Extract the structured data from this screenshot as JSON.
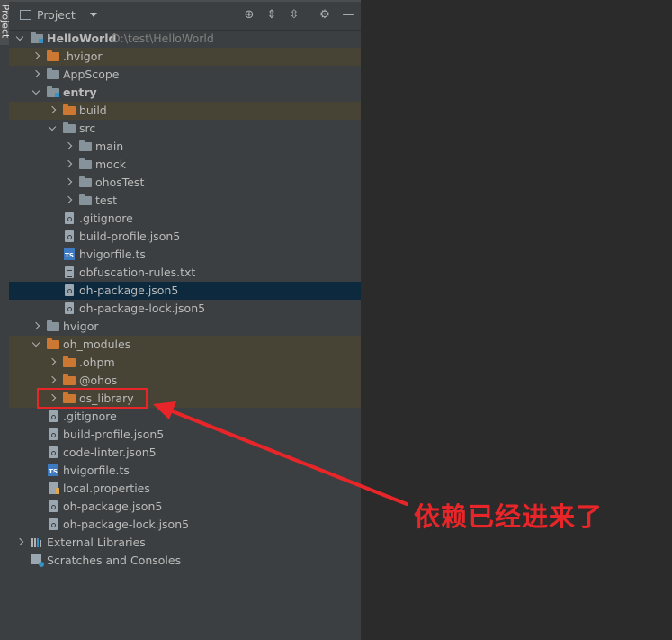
{
  "header": {
    "title": "Project",
    "icons": [
      "locate-icon",
      "expand-all-icon",
      "collapse-all-icon",
      "gear-icon",
      "minimize-icon"
    ]
  },
  "side_tab": {
    "label": "Project"
  },
  "tree": [
    {
      "label": "HelloWorld",
      "path": "D:\\test\\HelloWorld",
      "arrow": "down",
      "icon": "module-folder",
      "indent": 0,
      "bold": true
    },
    {
      "label": ".hvigor",
      "arrow": "right",
      "icon": "folder-orange",
      "indent": 1,
      "highlight": true
    },
    {
      "label": "AppScope",
      "arrow": "right",
      "icon": "folder",
      "indent": 1
    },
    {
      "label": "entry",
      "arrow": "down",
      "icon": "module-folder",
      "indent": 1,
      "bold": true
    },
    {
      "label": "build",
      "arrow": "right",
      "icon": "folder-orange",
      "indent": 2,
      "highlight": true
    },
    {
      "label": "src",
      "arrow": "down",
      "icon": "folder",
      "indent": 2
    },
    {
      "label": "main",
      "arrow": "right",
      "icon": "folder",
      "indent": 3
    },
    {
      "label": "mock",
      "arrow": "right",
      "icon": "folder",
      "indent": 3
    },
    {
      "label": "ohosTest",
      "arrow": "right",
      "icon": "folder",
      "indent": 3
    },
    {
      "label": "test",
      "arrow": "right",
      "icon": "folder",
      "indent": 3
    },
    {
      "label": ".gitignore",
      "icon": "config-file",
      "indent": 2
    },
    {
      "label": "build-profile.json5",
      "icon": "config-file",
      "indent": 2
    },
    {
      "label": "hvigorfile.ts",
      "icon": "ts-file",
      "indent": 2
    },
    {
      "label": "obfuscation-rules.txt",
      "icon": "text-file",
      "indent": 2
    },
    {
      "label": "oh-package.json5",
      "icon": "config-file",
      "indent": 2,
      "selected": true
    },
    {
      "label": "oh-package-lock.json5",
      "icon": "config-file",
      "indent": 2
    },
    {
      "label": "hvigor",
      "arrow": "right",
      "icon": "folder",
      "indent": 1
    },
    {
      "label": "oh_modules",
      "arrow": "down",
      "icon": "folder-orange",
      "indent": 1,
      "highlight": true
    },
    {
      "label": ".ohpm",
      "arrow": "right",
      "icon": "folder-orange",
      "indent": 2,
      "highlight": true
    },
    {
      "label": "@ohos",
      "arrow": "right",
      "icon": "folder-orange",
      "indent": 2,
      "highlight": true
    },
    {
      "label": "os_library",
      "arrow": "right",
      "icon": "folder-orange",
      "indent": 2,
      "highlight": true
    },
    {
      "label": ".gitignore",
      "icon": "config-file",
      "indent": 1
    },
    {
      "label": "build-profile.json5",
      "icon": "config-file",
      "indent": 1
    },
    {
      "label": "code-linter.json5",
      "icon": "config-file",
      "indent": 1
    },
    {
      "label": "hvigorfile.ts",
      "icon": "ts-file",
      "indent": 1
    },
    {
      "label": "local.properties",
      "icon": "properties-file",
      "indent": 1
    },
    {
      "label": "oh-package.json5",
      "icon": "config-file",
      "indent": 1
    },
    {
      "label": "oh-package-lock.json5",
      "icon": "config-file",
      "indent": 1
    },
    {
      "label": "External Libraries",
      "arrow": "right",
      "icon": "library",
      "indent": 0
    },
    {
      "label": "Scratches and Consoles",
      "icon": "scratches",
      "indent": 0
    }
  ],
  "annotation": {
    "text": "依赖已经进来了",
    "color": "#e8262a"
  }
}
